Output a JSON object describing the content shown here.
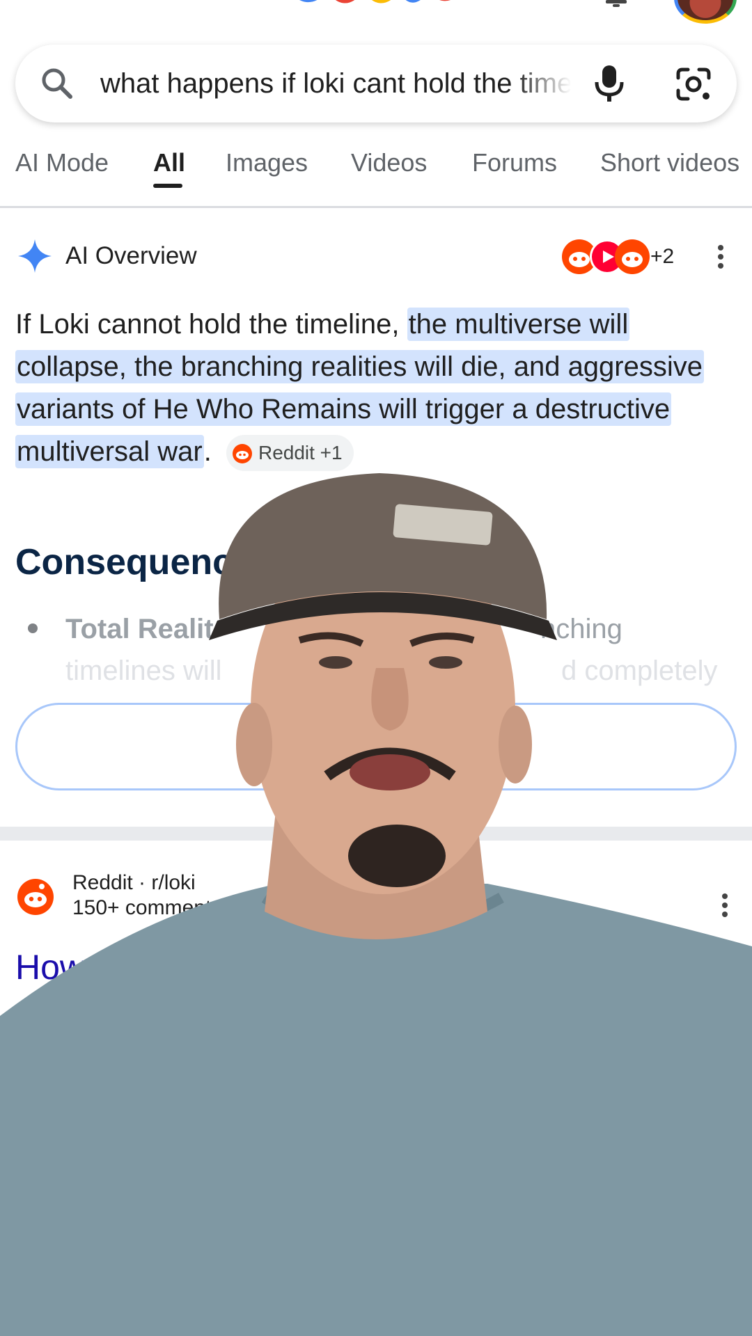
{
  "search": {
    "query": "what happens if loki cant hold the timeline"
  },
  "tabs": [
    {
      "label": "AI Mode"
    },
    {
      "label": "All"
    },
    {
      "label": "Images"
    },
    {
      "label": "Videos"
    },
    {
      "label": "Forums"
    },
    {
      "label": "Short videos"
    }
  ],
  "active_tab": "All",
  "ai_overview": {
    "title": "AI Overview",
    "sources_more": "+2",
    "text_plain": "If Loki cannot hold the timeline, ",
    "text_highlight": "the multiverse will collapse, the branching realities will die, and aggressive variants of He Who Remains will trigger a destructive multiversal war",
    "text_end": ".",
    "citation": "Reddit +1",
    "section_title": "Consequence",
    "bullet_lead": "Total Realit",
    "bullet_lead_tail": "nching",
    "bullet_line2": "timelines will",
    "bullet_line2_tail": "d completely"
  },
  "result": {
    "source": "Reddit · r/loki",
    "meta": "150+ comments · 2 y",
    "title_partial": "How"
  },
  "colors": {
    "highlight": "#d3e3fd",
    "link": "#1a0dab",
    "reddit": "#ff4500",
    "youtube": "#ff0000",
    "google_blue": "#4285f4"
  },
  "icons": [
    "google-logo",
    "notification-bell-icon",
    "account-avatar",
    "search-icon",
    "microphone-icon",
    "google-lens-icon",
    "gemini-sparkle-icon",
    "reddit-icon",
    "youtube-icon",
    "more-options-icon"
  ]
}
